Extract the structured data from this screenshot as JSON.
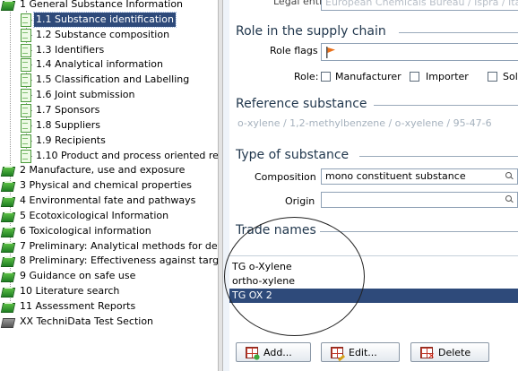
{
  "tree": {
    "items": [
      {
        "label": "1 General Substance Information",
        "icon": "green-book-icon",
        "level": 0
      },
      {
        "label": "1.1 Substance identification",
        "icon": "document-icon",
        "level": 1,
        "selected": true
      },
      {
        "label": "1.2 Substance composition",
        "icon": "document-icon",
        "level": 1
      },
      {
        "label": "1.3 Identifiers",
        "icon": "document-icon",
        "level": 1
      },
      {
        "label": "1.4 Analytical information",
        "icon": "document-icon",
        "level": 1
      },
      {
        "label": "1.5 Classification and Labelling",
        "icon": "document-icon",
        "level": 1
      },
      {
        "label": "1.6 Joint submission",
        "icon": "document-icon",
        "level": 1
      },
      {
        "label": "1.7 Sponsors",
        "icon": "document-icon",
        "level": 1
      },
      {
        "label": "1.8 Suppliers",
        "icon": "document-icon",
        "level": 1
      },
      {
        "label": "1.9 Recipients",
        "icon": "document-icon",
        "level": 1
      },
      {
        "label": "1.10 Product and process oriented re",
        "icon": "document-icon",
        "level": 1
      },
      {
        "label": "2 Manufacture, use and exposure",
        "icon": "green-book-icon",
        "level": 0
      },
      {
        "label": "3 Physical and chemical properties",
        "icon": "green-book-icon",
        "level": 0
      },
      {
        "label": "4 Environmental fate and pathways",
        "icon": "green-book-icon",
        "level": 0
      },
      {
        "label": "5 Ecotoxicological Information",
        "icon": "green-book-icon",
        "level": 0
      },
      {
        "label": "6 Toxicological information",
        "icon": "green-book-icon",
        "level": 0
      },
      {
        "label": "7 Preliminary: Analytical methods for dete",
        "icon": "green-book-icon",
        "level": 0
      },
      {
        "label": "8 Preliminary: Effectiveness against target",
        "icon": "green-book-icon",
        "level": 0
      },
      {
        "label": "9 Guidance on safe use",
        "icon": "green-book-icon",
        "level": 0
      },
      {
        "label": "10 Literature search",
        "icon": "green-book-icon",
        "level": 0
      },
      {
        "label": "11 Assessment Reports",
        "icon": "green-book-icon",
        "level": 0
      },
      {
        "label": "XX TechniData Test Section",
        "icon": "gray-book-icon",
        "level": 0
      }
    ]
  },
  "form": {
    "legal_entity_label": "Legal entity",
    "legal_entity_value": "European Chemicals Bureau / Ispra / Ital",
    "role_section_title": "Role in the supply chain",
    "role_flags_label": "Role flags",
    "role_label": "Role:",
    "role_options": [
      {
        "label": "Manufacturer",
        "checked": false
      },
      {
        "label": "Importer",
        "checked": false
      },
      {
        "label": "Sole",
        "checked": false
      }
    ],
    "reference_section_title": "Reference substance",
    "reference_value": "o-xylene / 1,2-methylbenzene / o-xyelene / 95-47-6",
    "type_section_title": "Type of substance",
    "composition_label": "Composition",
    "composition_value": "mono constituent substance",
    "origin_label": "Origin",
    "origin_value": "",
    "trade_section_title": "Trade names",
    "trade_names": [
      {
        "name": "TG o-Xylene",
        "selected": false
      },
      {
        "name": "ortho-xylene",
        "selected": false
      },
      {
        "name": "TG OX 2",
        "selected": true
      }
    ],
    "add_button": "Add...",
    "edit_button": "Edit...",
    "delete_button": "Delete"
  },
  "colors": {
    "selection": "#2e4a7a",
    "section_title": "#22384e",
    "flag": "#e8701a"
  }
}
